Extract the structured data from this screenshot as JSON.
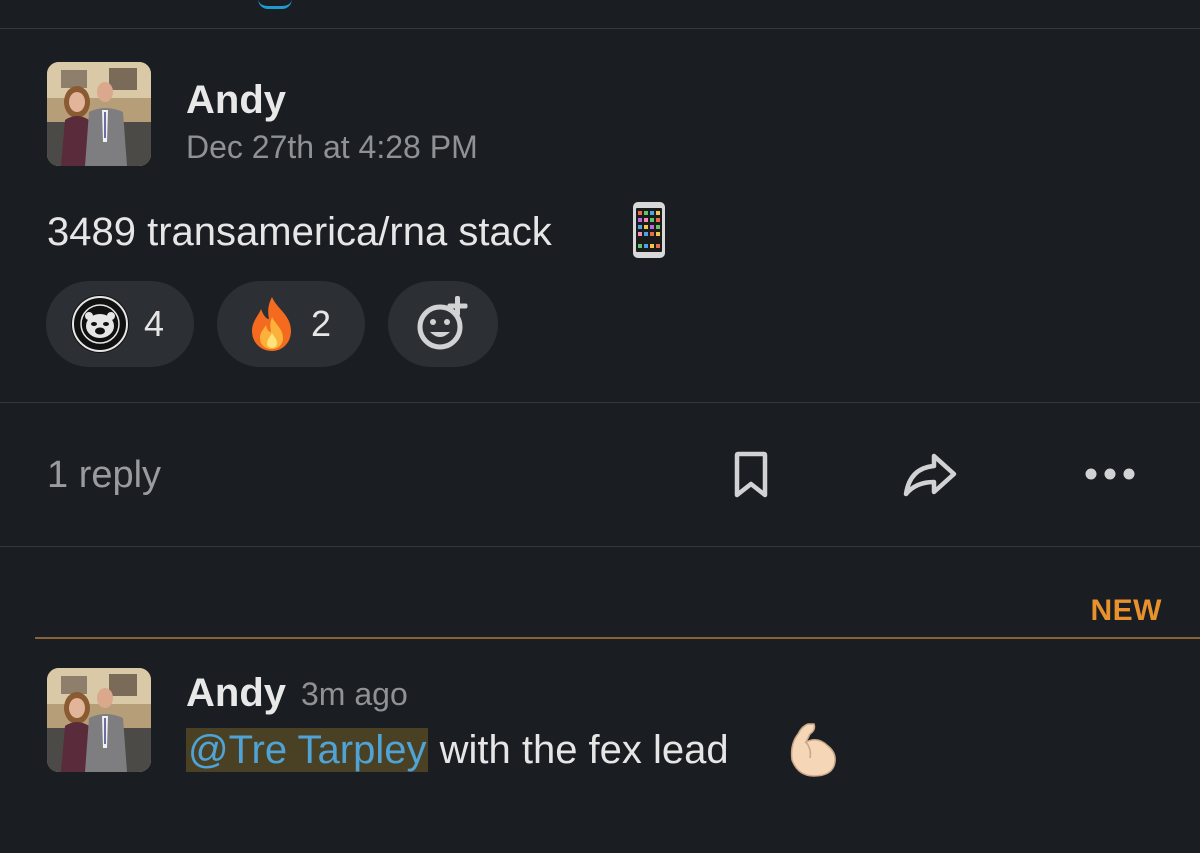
{
  "message": {
    "author": "Andy",
    "timestamp": "Dec 27th at 4:28 PM",
    "text": "3489 transamerica/rna stack",
    "trailing_emoji": "mobile-phone-icon",
    "reactions": [
      {
        "emoji": "bear-badge-emoji",
        "count": "4"
      },
      {
        "emoji": "fire-emoji",
        "count": "2"
      }
    ],
    "add_reaction_icon": "add-reaction-icon"
  },
  "thread_bar": {
    "reply_label": "1 reply",
    "icons": [
      "bookmark-icon",
      "share-icon",
      "more-icon"
    ]
  },
  "new_divider": {
    "label": "NEW",
    "color": "#e8912d"
  },
  "reply": {
    "author": "Andy",
    "time": "3m ago",
    "mention": "@Tre Tarpley",
    "text": " with the fex lead",
    "trailing_emoji": "flexed-biceps-icon"
  },
  "colors": {
    "background": "#1a1d21",
    "reaction_bg": "#2c2f33",
    "mention_text": "#4fa3d6",
    "mention_bg": "#4a4124"
  }
}
